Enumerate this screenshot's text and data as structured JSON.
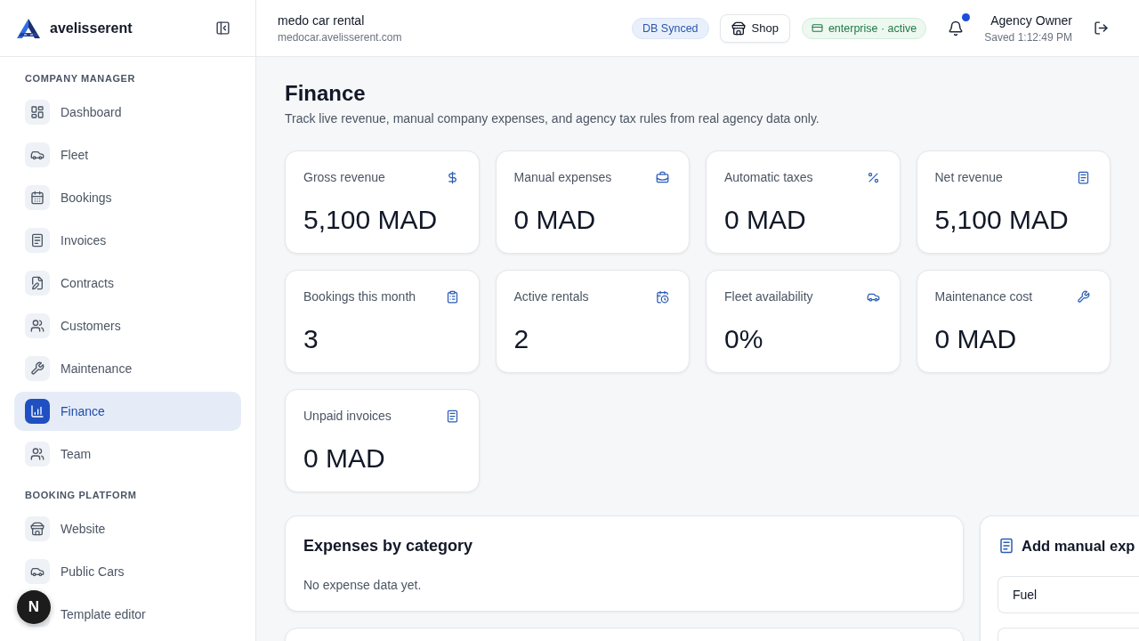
{
  "sidebar": {
    "brand": {
      "name": "avelisserent"
    },
    "sections": [
      {
        "title": "COMPANY MANAGER",
        "items": [
          {
            "label": "Dashboard",
            "selected": false
          },
          {
            "label": "Fleet",
            "selected": false
          },
          {
            "label": "Bookings",
            "selected": false
          },
          {
            "label": "Invoices",
            "selected": false
          },
          {
            "label": "Contracts",
            "selected": false
          },
          {
            "label": "Customers",
            "selected": false
          },
          {
            "label": "Maintenance",
            "selected": false
          },
          {
            "label": "Finance",
            "selected": true
          },
          {
            "label": "Team",
            "selected": false
          }
        ]
      },
      {
        "title": "BOOKING PLATFORM",
        "items": [
          {
            "label": "Website",
            "selected": false
          },
          {
            "label": "Public Cars",
            "selected": false
          },
          {
            "label": "Template editor",
            "selected": false
          }
        ]
      }
    ]
  },
  "dev_indicator": {
    "label": "N"
  },
  "topbar": {
    "agency": {
      "name": "medo car rental",
      "domain": "medocar.avelisserent.com"
    },
    "sync_badge": "DB Synced",
    "shop_button": "Shop",
    "plan_badge": "enterprise · active",
    "notifications": {
      "unread": true
    },
    "user": {
      "name": "Agency Owner",
      "saved": "Saved 1:12:49 PM"
    }
  },
  "page": {
    "title": "Finance",
    "subtitle": "Track live revenue, manual company expenses, and agency tax rules from real agency data only."
  },
  "stats": [
    {
      "label": "Gross revenue",
      "value": "5,100 MAD"
    },
    {
      "label": "Manual expenses",
      "value": "0 MAD"
    },
    {
      "label": "Automatic taxes",
      "value": "0 MAD"
    },
    {
      "label": "Net revenue",
      "value": "5,100 MAD"
    },
    {
      "label": "Bookings this month",
      "value": "3"
    },
    {
      "label": "Active rentals",
      "value": "2"
    },
    {
      "label": "Fleet availability",
      "value": "0%"
    },
    {
      "label": "Maintenance cost",
      "value": "0 MAD"
    },
    {
      "label": "Unpaid invoices",
      "value": "0 MAD"
    }
  ],
  "expenses_panel": {
    "title": "Expenses by category",
    "empty_text": "No expense data yet."
  },
  "expense_form": {
    "title": "Add manual exp",
    "fields": [
      {
        "kind": "select",
        "value": "Fuel"
      },
      {
        "kind": "input"
      }
    ]
  }
}
